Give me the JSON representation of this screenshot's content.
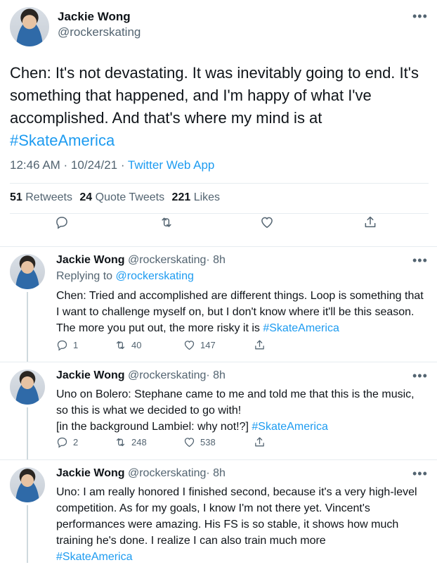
{
  "main": {
    "author": "Jackie Wong",
    "handle": "@rockerskating",
    "text": "Chen: It's not devastating. It was inevitably going to end. It's something that happened, and I'm happy of what I've accomplished. And that's where my mind is at",
    "hashtag": "#SkateAmerica",
    "time": "12:46 AM · 10/24/21 · ",
    "source": "Twitter Web App",
    "stats": {
      "retweets_count": "51",
      "retweets_label": "Retweets",
      "quotes_count": "24",
      "quotes_label": "Quote Tweets",
      "likes_count": "221",
      "likes_label": "Likes"
    },
    "more_icon": "more-dots-icon",
    "actions": [
      "reply-icon",
      "retweet-icon",
      "like-icon",
      "share-icon"
    ]
  },
  "replies": [
    {
      "author": "Jackie Wong",
      "handle": "@rockerskating",
      "age": "· 8h",
      "replying_prefix": "Replying to ",
      "replying_to": "@rockerskating",
      "text": "Chen: Tried and accomplished are different things. Loop is something that I want to challenge myself on, but I don't know where it'll be this season. The more you put out, the more risky it is ",
      "hashtag": "#SkateAmerica",
      "reply_count": "1",
      "retweet_count": "40",
      "like_count": "147"
    },
    {
      "author": "Jackie Wong",
      "handle": "@rockerskating",
      "age": "· 8h",
      "text": "Uno on Bolero: Stephane came to me and told me that this is the music, so this is what we decided to go with!",
      "text2": "[in the background Lambiel: why not!?] ",
      "hashtag": "#SkateAmerica",
      "reply_count": "2",
      "retweet_count": "248",
      "like_count": "538"
    },
    {
      "author": "Jackie Wong",
      "handle": "@rockerskating",
      "age": "· 8h",
      "text": "Uno: I am really honored I finished second, because it's a very high-level competition. As for my goals, I know I'm not there yet. Vincent's performances were amazing. His FS is so stable, it shows how much training he's done. I realize I can also train much more",
      "hashtag": "#SkateAmerica"
    }
  ],
  "colors": {
    "link": "#1d9bf0",
    "muted": "#536471",
    "divider": "#e6ecf0"
  }
}
